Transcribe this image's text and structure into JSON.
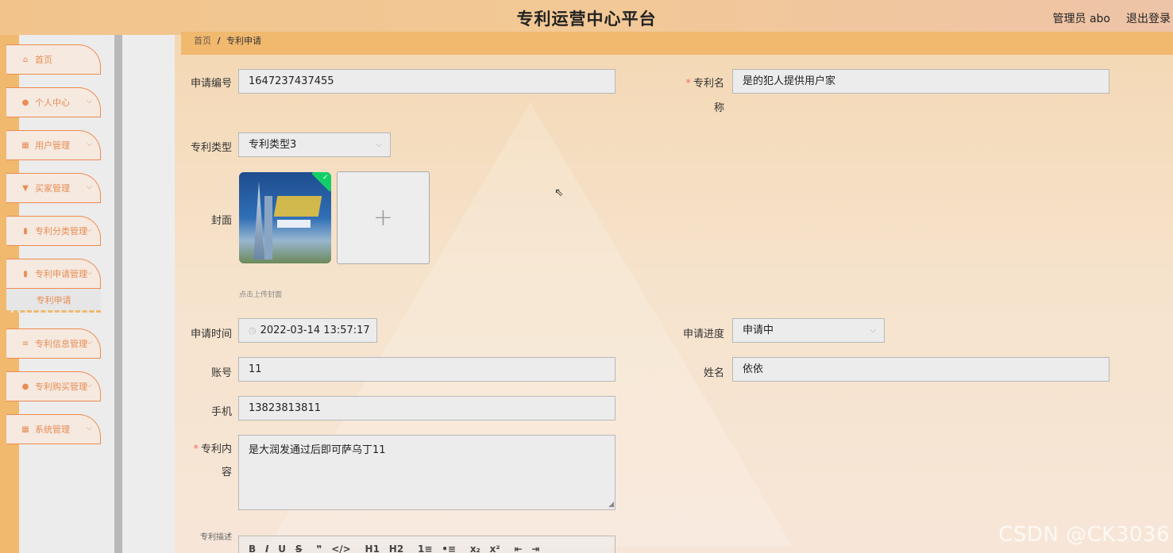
{
  "header": {
    "title": "专利运营中心平台",
    "user": "管理员 abo",
    "logout": "退出登录"
  },
  "sidebar": {
    "items": [
      {
        "label": "首页",
        "icon": "home-icon",
        "glyph": "⌂",
        "has_chevron": false
      },
      {
        "label": "个人中心",
        "icon": "user-icon",
        "glyph": "●",
        "has_chevron": true
      },
      {
        "label": "用户管理",
        "icon": "grid-icon",
        "glyph": "▦",
        "has_chevron": true
      },
      {
        "label": "买家管理",
        "icon": "trophy-icon",
        "glyph": "▼",
        "has_chevron": true
      },
      {
        "label": "专利分类管理",
        "icon": "chart-icon",
        "glyph": "▮",
        "has_chevron": true
      },
      {
        "label": "专利申请管理",
        "icon": "clipboard-icon",
        "glyph": "▮",
        "has_chevron": true
      },
      {
        "label": "专利信息管理",
        "icon": "sliders-icon",
        "glyph": "≡",
        "has_chevron": true
      },
      {
        "label": "专利购买管理",
        "icon": "person-icon",
        "glyph": "●",
        "has_chevron": true
      },
      {
        "label": "系统管理",
        "icon": "grid-icon",
        "glyph": "▦",
        "has_chevron": true
      }
    ],
    "submenu_active": "专利申请"
  },
  "breadcrumb": {
    "home": "首页",
    "separator": "/",
    "current": "专利申请"
  },
  "form": {
    "apply_no": {
      "label": "申请编号",
      "value": "1647237437455"
    },
    "patent_name": {
      "label_line1": "专利名",
      "label_line2": "称",
      "value": "是的犯人提供用户家",
      "required": "*"
    },
    "patent_type": {
      "label": "专利类型",
      "value": "专利类型3"
    },
    "cover": {
      "label": "封面",
      "tip": "点击上传封面",
      "add": "+"
    },
    "apply_time": {
      "label": "申请时间",
      "value": "2022-03-14 13:57:17"
    },
    "progress": {
      "label": "申请进度",
      "value": "申请中"
    },
    "account": {
      "label": "账号",
      "value": "11"
    },
    "name": {
      "label": "姓名",
      "value": "依依"
    },
    "phone": {
      "label": "手机",
      "value": "13823813811"
    },
    "content": {
      "label_line1": "专利内",
      "label_line2": "容",
      "value": "是大润发通过后即可萨乌丁11",
      "required": "*"
    },
    "description": {
      "label": "专利描述"
    }
  },
  "editor_toolbar": [
    "B",
    "I",
    "U",
    "S",
    "❞",
    "</>",
    "H1",
    "H2",
    "1≡",
    "•≡",
    "x₂",
    "x²",
    "⇤",
    "⇥"
  ],
  "watermark": "CSDN @CK3036",
  "colors": {
    "accent": "#f0b96e",
    "menu_text": "#e88d53",
    "required": "#f56c6c"
  }
}
